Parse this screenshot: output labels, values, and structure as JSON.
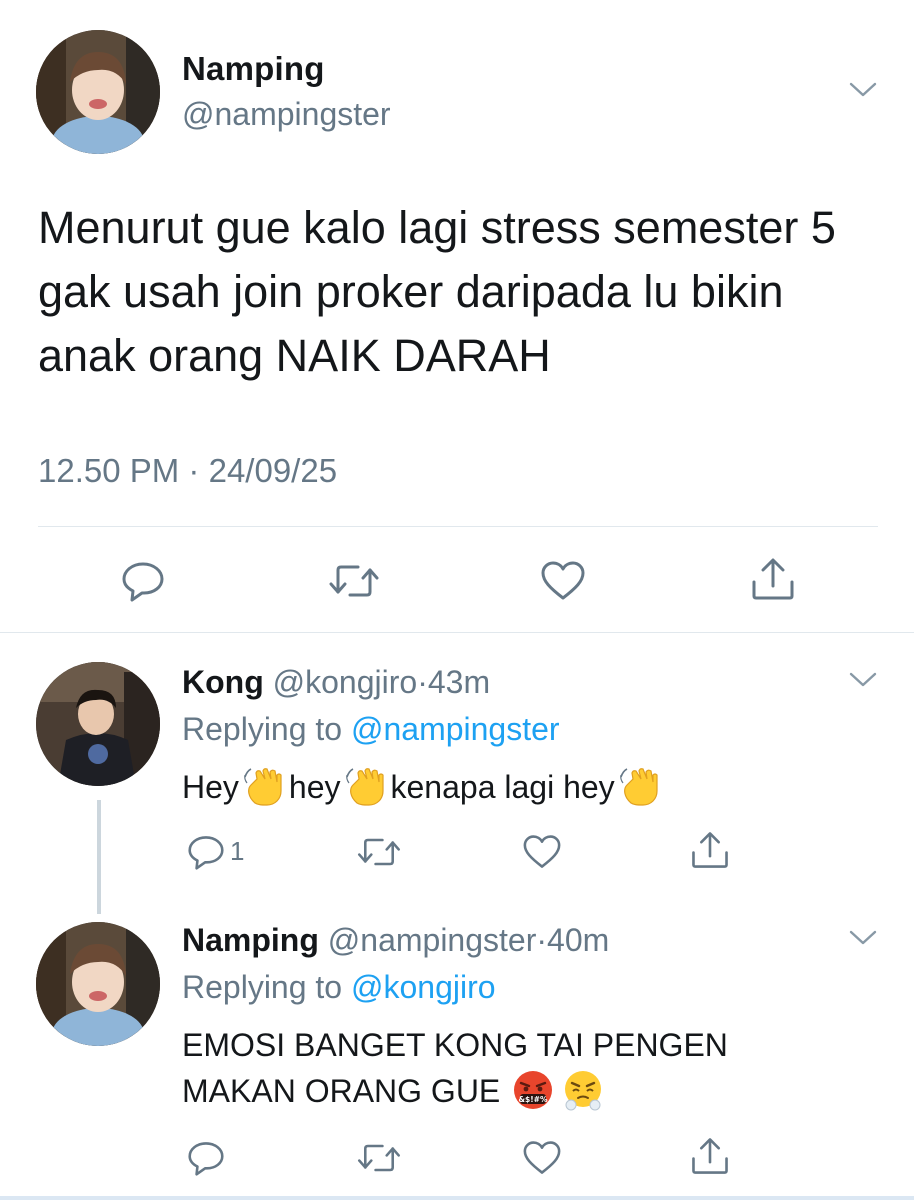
{
  "main_tweet": {
    "name": "Namping",
    "handle": "@nampingster",
    "text": "Menurut gue kalo lagi stress semester 5 gak usah join proker daripada lu bikin anak orang NAIK DARAH",
    "time": "12.50 PM",
    "separator": "·",
    "date": "24/09/25",
    "icons": {
      "reply": "reply-icon",
      "retweet": "retweet-icon",
      "like": "like-icon",
      "share": "share-icon"
    }
  },
  "replies": [
    {
      "name": "Kong",
      "handle": "@kongjiro",
      "separator": "·",
      "time": "43m",
      "replying_prefix": "Replying to",
      "replying_to": "@nampingster",
      "text_parts": [
        "Hey",
        "hey",
        "kenapa lagi hey"
      ],
      "emoji": "waving-hand-emoji",
      "reply_count": "1"
    },
    {
      "name": "Namping",
      "handle": "@nampingster",
      "separator": "·",
      "time": "40m",
      "replying_prefix": "Replying to",
      "replying_to": "@kongjiro",
      "text_line1": "EMOSI BANGET KONG TAI PENGEN",
      "text_line2": "MAKAN ORANG GUE",
      "emojis": [
        "face-with-symbols-emoji",
        "face-with-steam-emoji"
      ]
    }
  ],
  "colors": {
    "text": "#14171a",
    "secondary": "#657786",
    "mention": "#1da1f2",
    "divider": "#e1e8ed",
    "icon": "#657786"
  }
}
